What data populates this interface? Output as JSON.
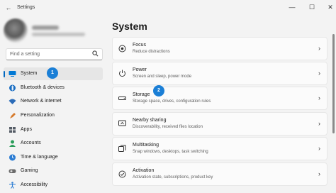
{
  "window": {
    "title": "Settings",
    "back_glyph": "←",
    "minimize_glyph": "—",
    "maximize_glyph": "☐",
    "close_glyph": "✕"
  },
  "search": {
    "placeholder": "Find a setting",
    "icon": "search-icon"
  },
  "sidebar": {
    "items": [
      {
        "label": "System",
        "icon": "system-icon",
        "color": "#0078d4",
        "active": true
      },
      {
        "label": "Bluetooth & devices",
        "icon": "bluetooth-icon",
        "color": "#1b6ec2"
      },
      {
        "label": "Network & internet",
        "icon": "network-icon",
        "color": "#2b6cb8"
      },
      {
        "label": "Personalization",
        "icon": "personalization-icon",
        "color": "#d67a2c"
      },
      {
        "label": "Apps",
        "icon": "apps-icon",
        "color": "#555c66"
      },
      {
        "label": "Accounts",
        "icon": "accounts-icon",
        "color": "#2a9d5a"
      },
      {
        "label": "Time & language",
        "icon": "time-language-icon",
        "color": "#2b7cd3"
      },
      {
        "label": "Gaming",
        "icon": "gaming-icon",
        "color": "#6b6b6b"
      },
      {
        "label": "Accessibility",
        "icon": "accessibility-icon",
        "color": "#2b7cd3"
      }
    ]
  },
  "main": {
    "title": "System",
    "cards": [
      {
        "title": "Focus",
        "subtitle": "Reduce distractions",
        "icon": "focus-icon"
      },
      {
        "title": "Power",
        "subtitle": "Screen and sleep, power mode",
        "icon": "power-icon"
      },
      {
        "title": "Storage",
        "subtitle": "Storage space, drives, configuration rules",
        "icon": "storage-icon"
      },
      {
        "title": "Nearby sharing",
        "subtitle": "Discoverability, received files location",
        "icon": "nearby-sharing-icon"
      },
      {
        "title": "Multitasking",
        "subtitle": "Snap windows, desktops, task switching",
        "icon": "multitasking-icon"
      },
      {
        "title": "Activation",
        "subtitle": "Activation state, subscriptions, product key",
        "icon": "activation-icon"
      }
    ],
    "chevron": "›"
  },
  "annotations": {
    "badge_1": "1",
    "badge_2": "2",
    "badge_color": "#1b7fd6"
  }
}
